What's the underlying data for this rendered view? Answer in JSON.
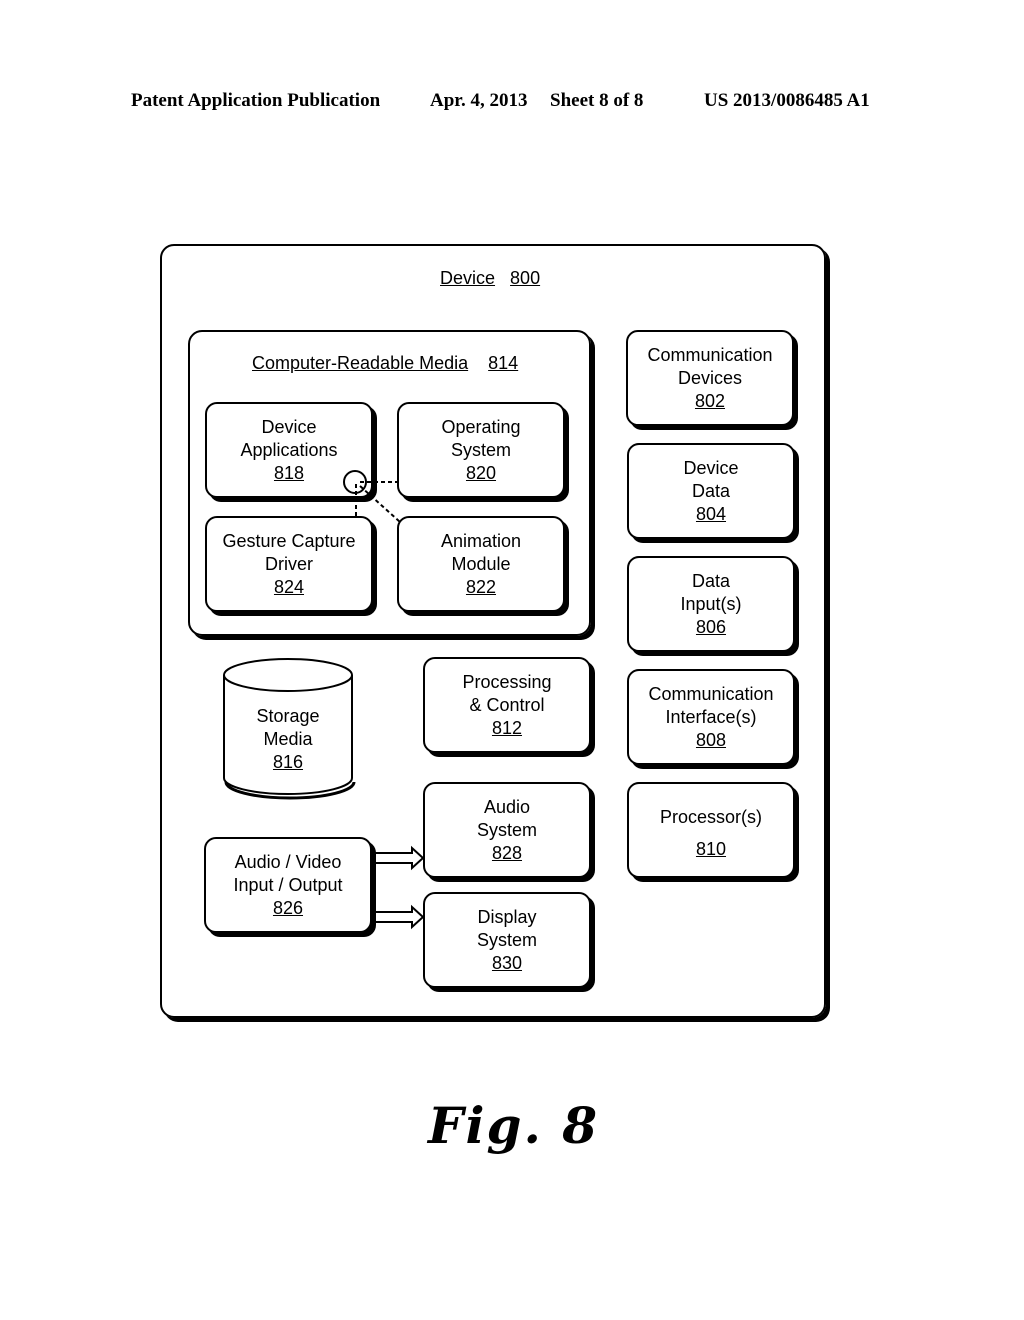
{
  "header": {
    "publication": "Patent Application Publication",
    "date": "Apr. 4, 2013",
    "sheet": "Sheet 8 of 8",
    "number": "US 2013/0086485 A1"
  },
  "device": {
    "label": "Device",
    "num": "800"
  },
  "crm": {
    "label": "Computer-Readable Media",
    "num": "814"
  },
  "blocks": {
    "device_apps": {
      "l1": "Device",
      "l2": "Applications",
      "num": "818"
    },
    "os": {
      "l1": "Operating",
      "l2": "System",
      "num": "820"
    },
    "gesture": {
      "l1": "Gesture Capture",
      "l2": "Driver",
      "num": "824"
    },
    "animation": {
      "l1": "Animation",
      "l2": "Module",
      "num": "822"
    },
    "storage": {
      "l1": "Storage",
      "l2": "Media",
      "num": "816"
    },
    "processing": {
      "l1": "Processing",
      "l2": "& Control",
      "num": "812"
    },
    "audio": {
      "l1": "Audio",
      "l2": "System",
      "num": "828"
    },
    "av_io": {
      "l1": "Audio / Video",
      "l2": "Input / Output",
      "num": "826"
    },
    "display": {
      "l1": "Display",
      "l2": "System",
      "num": "830"
    },
    "comm_devices": {
      "l1": "Communication",
      "l2": "Devices",
      "num": "802"
    },
    "device_data": {
      "l1": "Device",
      "l2": "Data",
      "num": "804"
    },
    "data_inputs": {
      "l1": "Data",
      "l2": "Input(s)",
      "num": "806"
    },
    "comm_interfaces": {
      "l1": "Communication",
      "l2": "Interface(s)",
      "num": "808"
    },
    "processors": {
      "l1": "Processor(s)",
      "num": "810"
    }
  },
  "figure": {
    "label": "Fig. 8"
  }
}
